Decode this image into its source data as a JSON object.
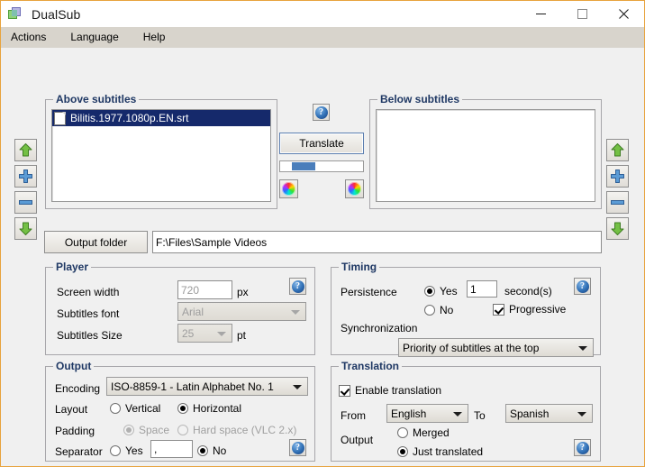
{
  "window": {
    "title": "DualSub",
    "app_icon": "dual-squares-icon",
    "accent_border": "#e8a33d",
    "controls": {
      "minimize": "minimize-icon",
      "maximize": "maximize-icon",
      "close": "close-icon"
    }
  },
  "menubar": {
    "items": [
      {
        "label": "Actions"
      },
      {
        "label": "Language"
      },
      {
        "label": "Help"
      }
    ]
  },
  "left_toolbar": {
    "buttons": [
      {
        "name": "move-up",
        "icon": "green-up-arrow-icon"
      },
      {
        "name": "add",
        "icon": "blue-plus-icon"
      },
      {
        "name": "remove",
        "icon": "blue-minus-icon"
      },
      {
        "name": "move-down",
        "icon": "green-down-arrow-icon"
      }
    ]
  },
  "right_toolbar": {
    "buttons": [
      {
        "name": "move-up",
        "icon": "green-up-arrow-icon"
      },
      {
        "name": "add",
        "icon": "blue-plus-icon"
      },
      {
        "name": "remove",
        "icon": "blue-minus-icon"
      },
      {
        "name": "move-down",
        "icon": "green-down-arrow-icon"
      }
    ]
  },
  "above_subtitles": {
    "title": "Above subtitles",
    "items": [
      {
        "label": "Bilitis.1977.1080p.EN.srt",
        "icon": "document-icon",
        "selected": true
      }
    ]
  },
  "below_subtitles": {
    "title": "Below subtitles",
    "items": []
  },
  "center": {
    "help_icon": "help-icon",
    "translate_label": "Translate",
    "progress_percent": 30,
    "color_left_icon": "color-wheel-icon",
    "color_right_icon": "color-wheel-icon"
  },
  "output_folder": {
    "button_label": "Output folder",
    "path": "F:\\Files\\Sample Videos"
  },
  "player": {
    "title": "Player",
    "screen_width_label": "Screen width",
    "screen_width_value": "720",
    "screen_width_unit": "px",
    "font_label": "Subtitles font",
    "font_value": "Arial",
    "size_label": "Subtitles Size",
    "size_value": "25",
    "size_unit": "pt",
    "help_icon": "help-icon"
  },
  "timing": {
    "title": "Timing",
    "persistence_label": "Persistence",
    "yes_label": "Yes",
    "no_label": "No",
    "seconds_value": "1",
    "seconds_unit": "second(s)",
    "progressive_label": "Progressive",
    "synchronization_label": "Synchronization",
    "sync_value": "Priority of subtitles at the top",
    "help_icon": "help-icon"
  },
  "output": {
    "title": "Output",
    "encoding_label": "Encoding",
    "encoding_value": "ISO-8859-1 - Latin Alphabet No. 1",
    "layout_label": "Layout",
    "layout_vertical": "Vertical",
    "layout_horizontal": "Horizontal",
    "padding_label": "Padding",
    "padding_space": "Space",
    "padding_hard": "Hard space (VLC 2.x)",
    "separator_label": "Separator",
    "separator_yes": "Yes",
    "separator_no": "No",
    "separator_value": ",",
    "help_icon": "help-icon"
  },
  "translation": {
    "title": "Translation",
    "enable_label": "Enable translation",
    "from_label": "From",
    "from_value": "English",
    "to_label": "To",
    "to_value": "Spanish",
    "output_label": "Output",
    "merged_label": "Merged",
    "just_translated_label": "Just translated",
    "help_icon": "help-icon"
  }
}
